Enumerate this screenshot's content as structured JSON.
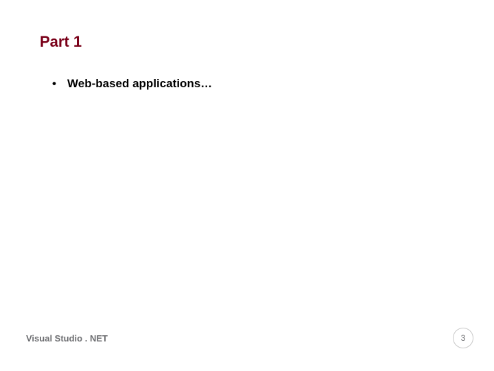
{
  "slide": {
    "title": "Part 1",
    "bullets": [
      "Web-based applications…"
    ]
  },
  "footer": {
    "label": "Visual Studio . NET",
    "page_number": "3"
  }
}
